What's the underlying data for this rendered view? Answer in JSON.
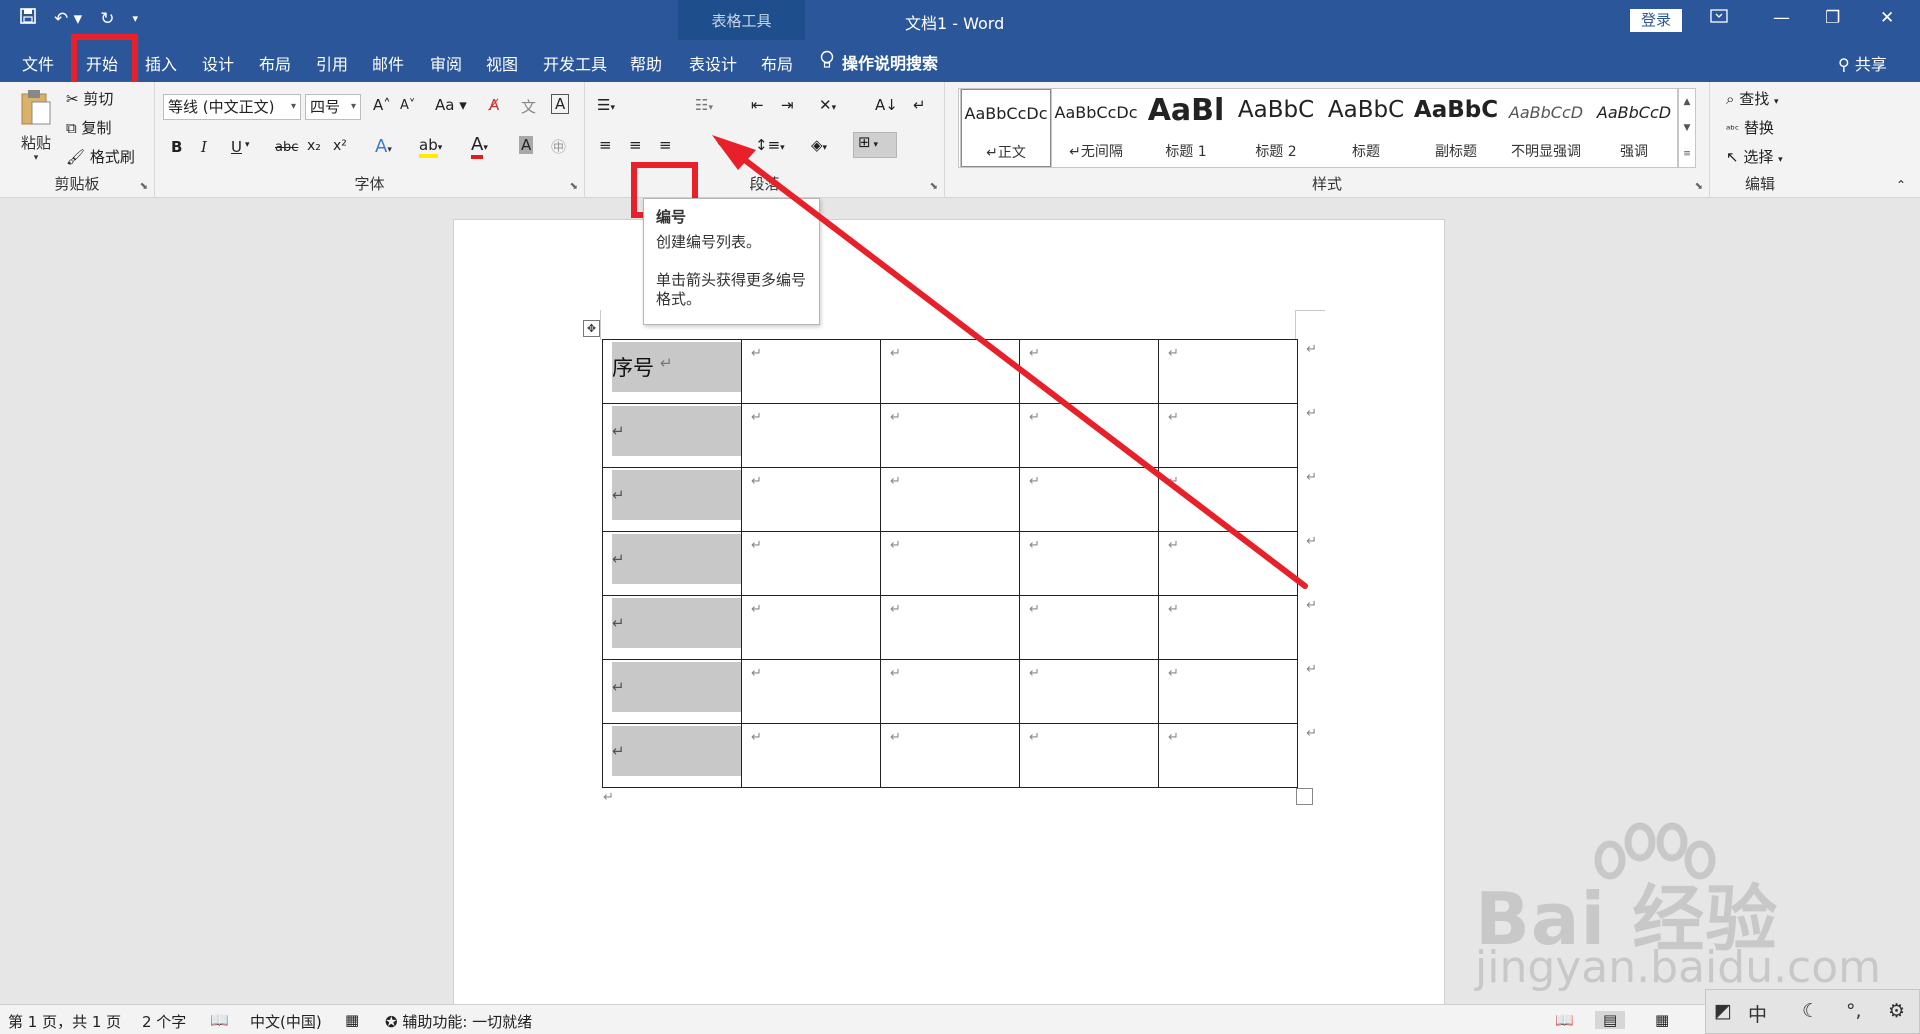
{
  "title_bar": {
    "context_tab": "表格工具",
    "doc_title": "文档1 - Word",
    "login_label": "登录",
    "qat_icons": [
      "save-icon",
      "undo-icon",
      "redo-icon",
      "customize-icon"
    ]
  },
  "tabs": {
    "file": "文件",
    "home": "开始",
    "insert": "插入",
    "design": "设计",
    "layout": "布局",
    "references": "引用",
    "mailings": "邮件",
    "review": "审阅",
    "view": "视图",
    "developer": "开发工具",
    "help": "帮助",
    "table_design": "表设计",
    "table_layout": "布局",
    "tell_me": "操作说明搜索",
    "share": "共享"
  },
  "ribbon": {
    "clipboard": {
      "label": "剪贴板",
      "paste": "粘贴",
      "cut": "剪切",
      "copy": "复制",
      "format_painter": "格式刷"
    },
    "font": {
      "label": "字体",
      "font_name": "等线 (中文正文)",
      "font_size": "四号",
      "bold": "B",
      "italic": "I",
      "underline": "U",
      "strike": "abc",
      "subscript": "x₂",
      "superscript": "x²",
      "grow": "A",
      "shrink": "A",
      "case": "Aa",
      "font_color_letter": "A",
      "highlight_letter": "ab",
      "char_shading": "A",
      "char_border": "A"
    },
    "paragraph": {
      "label": "段落"
    },
    "styles": {
      "label": "样式",
      "items": [
        {
          "preview": "AaBbCcDc",
          "name": "↵正文"
        },
        {
          "preview": "AaBbCcDc",
          "name": "↵无间隔"
        },
        {
          "preview": "AaBl",
          "name": "标题 1"
        },
        {
          "preview": "AaBbC",
          "name": "标题 2"
        },
        {
          "preview": "AaBbC",
          "name": "标题"
        },
        {
          "preview": "AaBbC",
          "name": "副标题"
        },
        {
          "preview": "AaBbCcD",
          "name": "不明显强调"
        },
        {
          "preview": "AaBbCcD",
          "name": "强调"
        }
      ]
    },
    "editing": {
      "label": "编辑",
      "find": "查找",
      "replace": "替换",
      "select": "选择"
    }
  },
  "tooltip": {
    "title": "编号",
    "line1": "创建编号列表。",
    "line2": "单击箭头获得更多编号",
    "line3": "格式。"
  },
  "document": {
    "header_cell": "序号",
    "rows": 7,
    "cols": 5,
    "para_mark": "↵"
  },
  "status": {
    "page": "第 1 页，共 1 页",
    "words": "2 个字",
    "language": "中文(中国)",
    "accessibility": "辅助功能: 一切就绪"
  },
  "ime": {
    "lang": "中"
  },
  "watermark": {
    "main": "Bai 经验",
    "sub": "jingyan.baidu.com"
  },
  "colors": {
    "brand": "#2b579a",
    "highlight_red": "#e8202a"
  }
}
